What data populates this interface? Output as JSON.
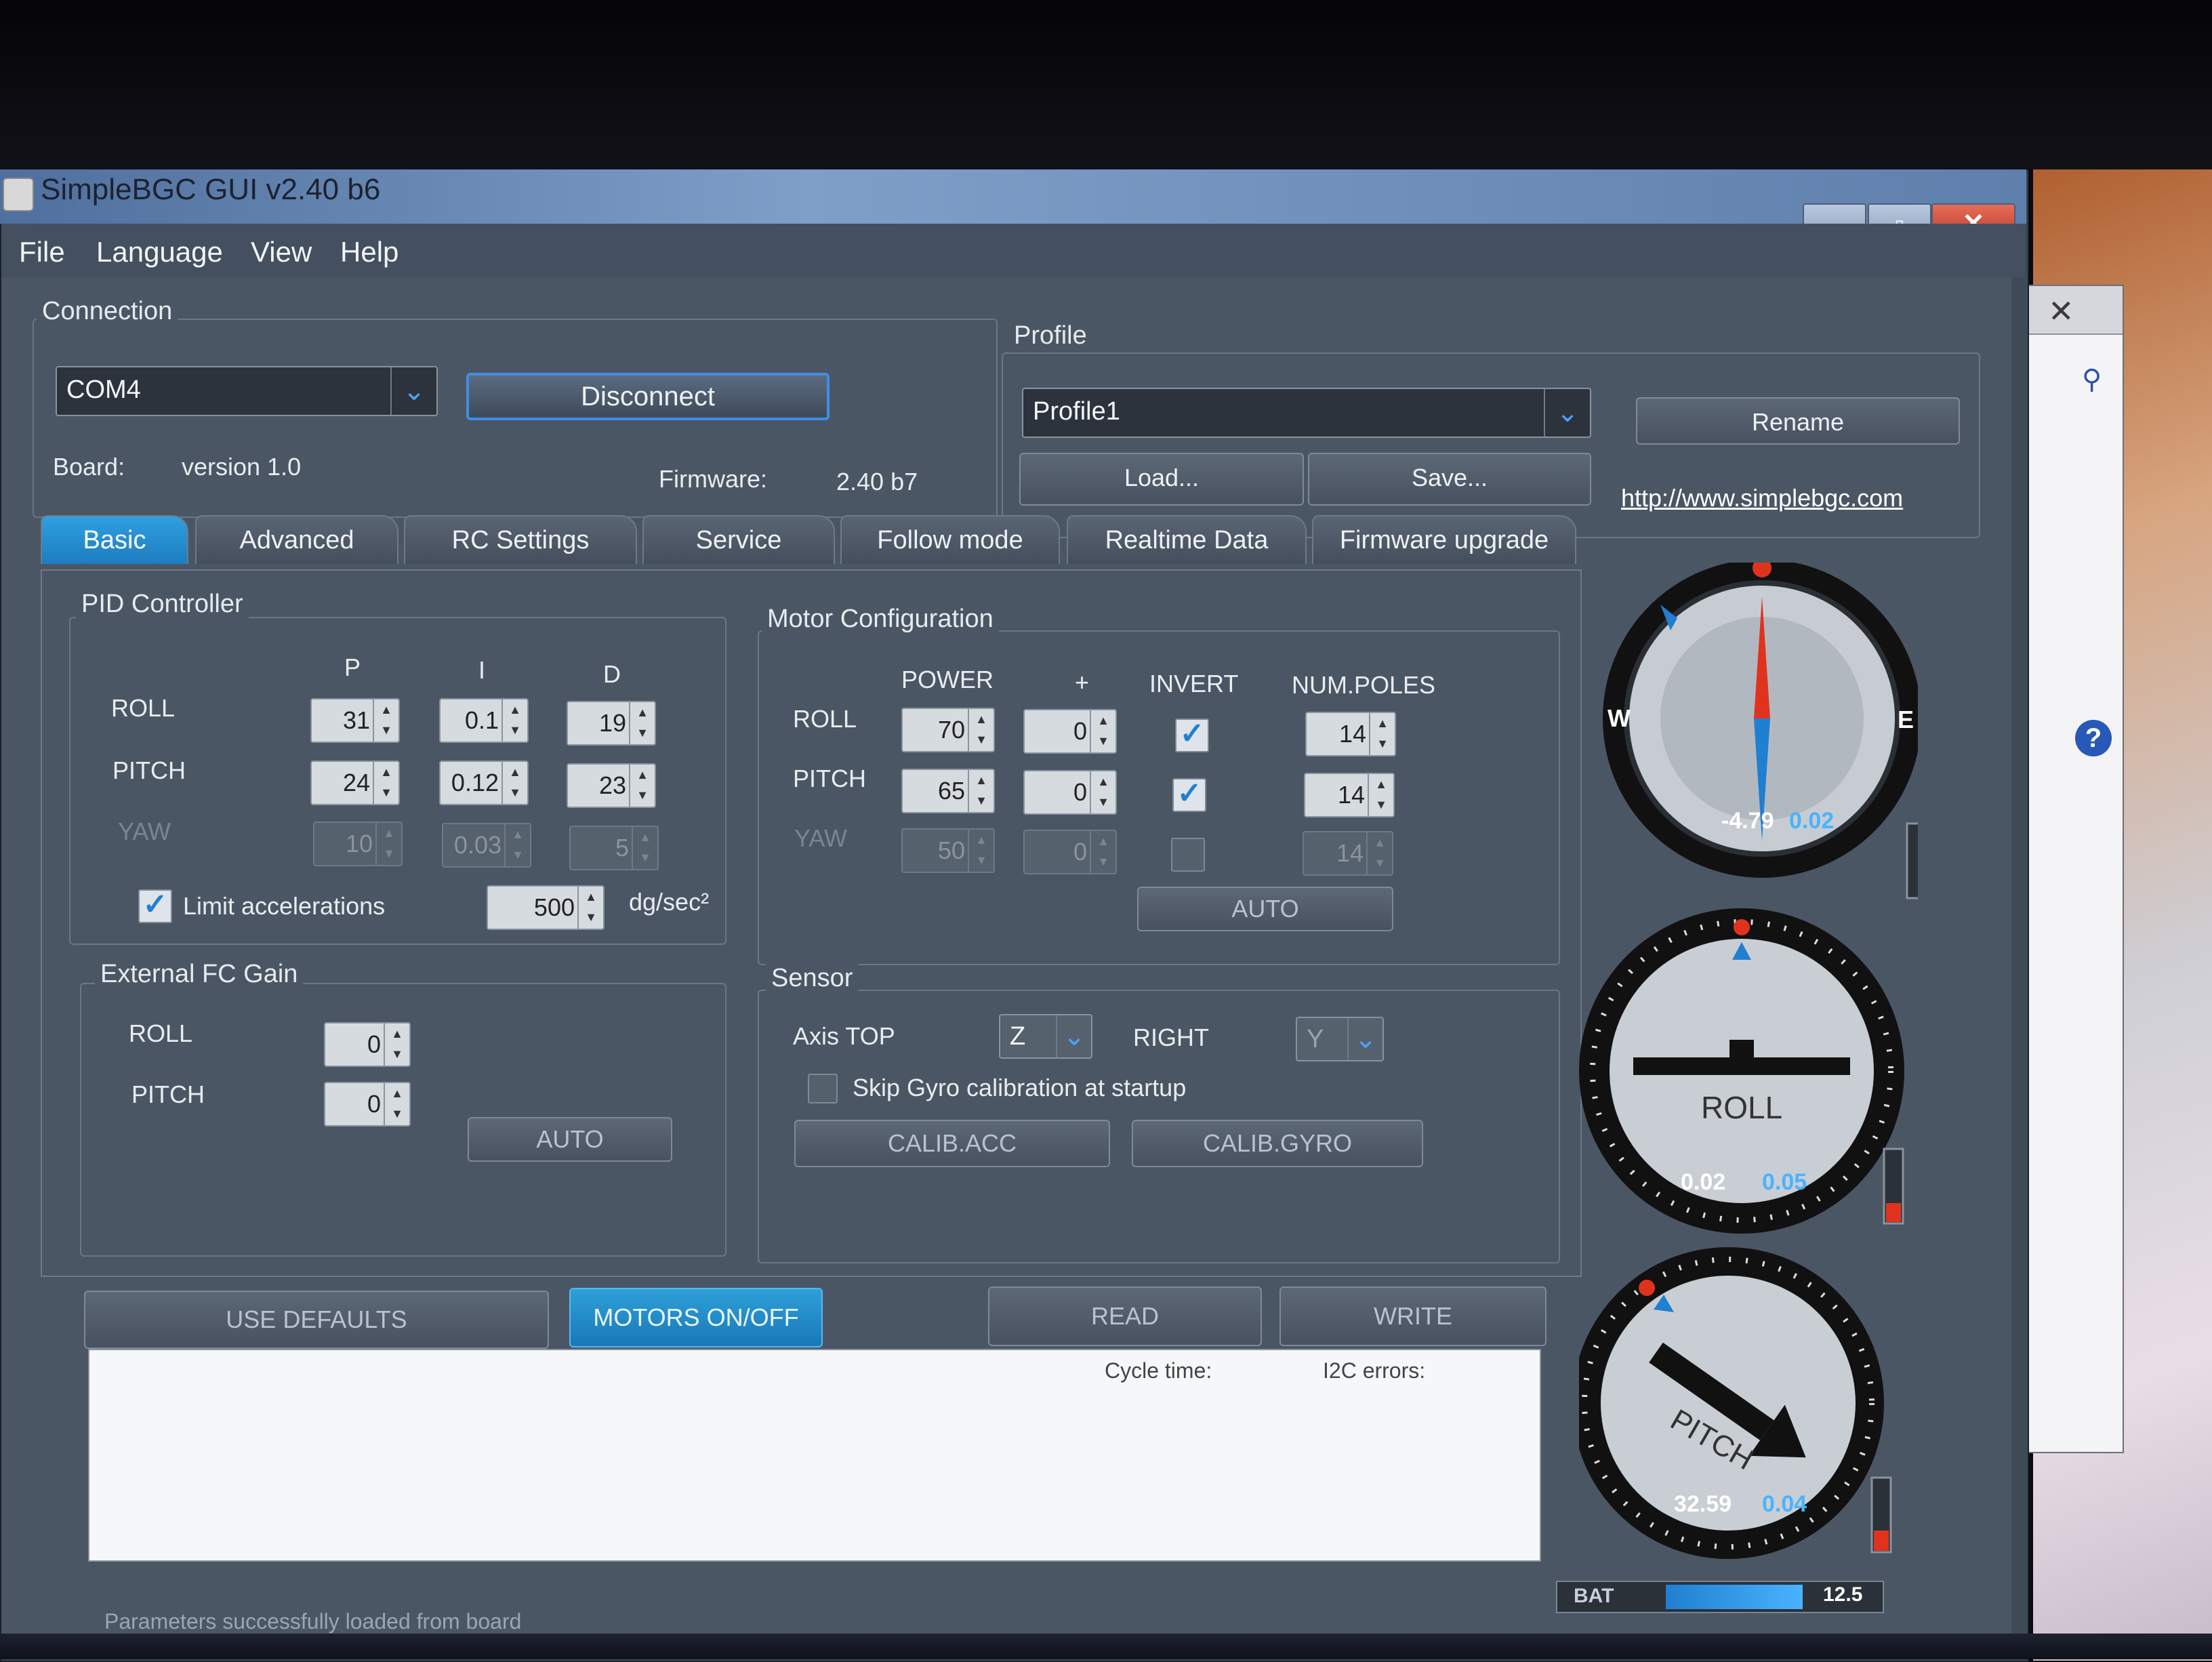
{
  "window": {
    "title": "SimpleBGC GUI v2.40 b6"
  },
  "menu": [
    "File",
    "Language",
    "View",
    "Help"
  ],
  "connection": {
    "group_title": "Connection",
    "port": "COM4",
    "disconnect_label": "Disconnect",
    "board_label": "Board:",
    "board_value": "version 1.0",
    "firmware_label": "Firmware:",
    "firmware_value": "2.40 b7"
  },
  "profile": {
    "group_title": "Profile",
    "selected": "Profile1",
    "rename_label": "Rename",
    "load_label": "Load...",
    "save_label": "Save...",
    "link": "http://www.simplebgc.com"
  },
  "tabs": [
    "Basic",
    "Advanced",
    "RC Settings",
    "Service",
    "Follow mode",
    "Realtime Data",
    "Firmware upgrade"
  ],
  "pid": {
    "group_title": "PID Controller",
    "headers": [
      "P",
      "I",
      "D"
    ],
    "rows": [
      {
        "name": "ROLL",
        "values": [
          "31",
          "0.1",
          "19"
        ],
        "enabled": true
      },
      {
        "name": "PITCH",
        "values": [
          "24",
          "0.12",
          "23"
        ],
        "enabled": true
      },
      {
        "name": "YAW",
        "values": [
          "10",
          "0.03",
          "5"
        ],
        "enabled": false
      }
    ],
    "limit_label": "Limit accelerations",
    "limit_value": "500",
    "limit_unit": "dg/sec²"
  },
  "motor": {
    "group_title": "Motor Configuration",
    "headers": [
      "POWER",
      "+",
      "INVERT",
      "NUM.POLES"
    ],
    "rows": [
      {
        "name": "ROLL",
        "power": "70",
        "plus": "0",
        "invert": true,
        "poles": "14",
        "enabled": true
      },
      {
        "name": "PITCH",
        "power": "65",
        "plus": "0",
        "invert": true,
        "poles": "14",
        "enabled": true
      },
      {
        "name": "YAW",
        "power": "50",
        "plus": "0",
        "invert": false,
        "poles": "14",
        "enabled": false
      }
    ],
    "auto_label": "AUTO"
  },
  "external_fc": {
    "group_title": "External FC Gain",
    "roll_label": "ROLL",
    "roll_value": "0",
    "pitch_label": "PITCH",
    "pitch_value": "0",
    "auto_label": "AUTO"
  },
  "sensor": {
    "group_title": "Sensor",
    "axis_top_label": "Axis TOP",
    "axis_top_value": "Z",
    "right_label": "RIGHT",
    "right_value": "Y",
    "skip_gyro_label": "Skip Gyro calibration at startup",
    "calib_acc_label": "CALIB.ACC",
    "calib_gyro_label": "CALIB.GYRO"
  },
  "actions": {
    "use_defaults": "USE DEFAULTS",
    "motors_onoff": "MOTORS ON/OFF",
    "read": "READ",
    "write": "WRITE"
  },
  "log": {
    "cycle_time_label": "Cycle time:",
    "i2c_errors_label": "I2C errors:"
  },
  "status": {
    "message": "Parameters successfully loaded from board"
  },
  "gauges": {
    "yaw": {
      "value": "-4.79",
      "rate": "0.02",
      "west": "W",
      "east": "E"
    },
    "roll": {
      "label": "ROLL",
      "value": "0.02",
      "rate": "0.05"
    },
    "pitch": {
      "label": "PITCH",
      "value": "32.59",
      "rate": "0.04"
    }
  },
  "battery": {
    "label": "BAT",
    "value": "12.5",
    "level": 0.65
  },
  "colors": {
    "accent": "#1f7fd1",
    "highlight": "#2ea0d8",
    "alert": "#e0331e"
  }
}
